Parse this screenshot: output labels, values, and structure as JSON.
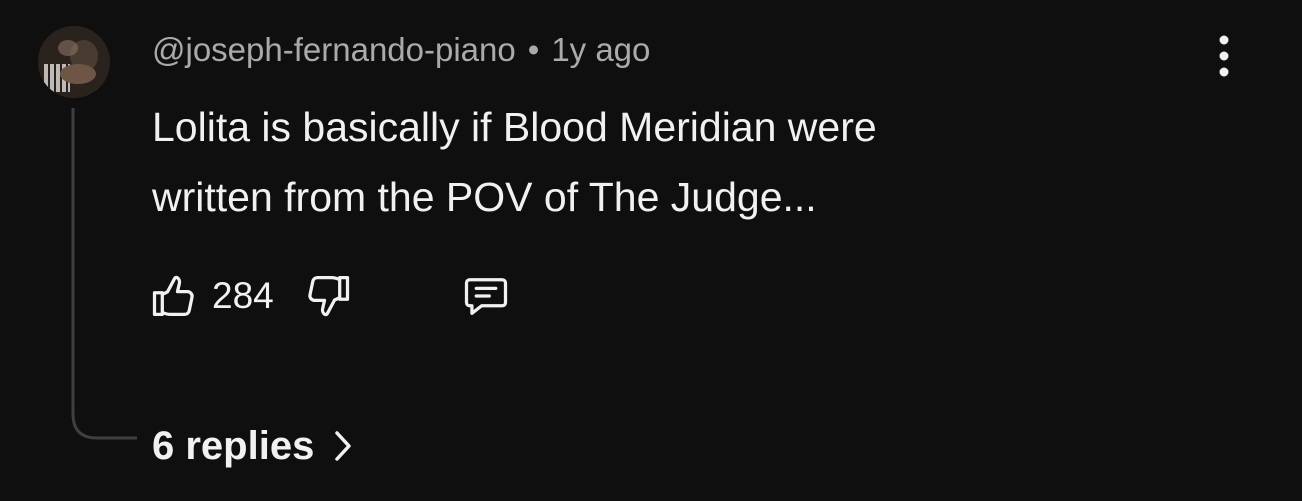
{
  "comment": {
    "author": "@joseph-fernando-piano",
    "separator": "•",
    "time": "1y ago",
    "text_lines": [
      "Lolita is basically if Blood Meridian were",
      "written from the POV of The Judge..."
    ],
    "like_count": "284",
    "replies_label": "6 replies",
    "icons": {
      "like": "thumbs-up-icon",
      "dislike": "thumbs-down-icon",
      "reply": "comment-icon",
      "menu": "more-vertical-icon",
      "replies": "chevron-right-icon"
    }
  },
  "colors": {
    "background": "#0f0f0f",
    "primary_text": "#f1f1f1",
    "secondary_text": "#aaaaaa",
    "thread_line": "#3f3f3f"
  }
}
